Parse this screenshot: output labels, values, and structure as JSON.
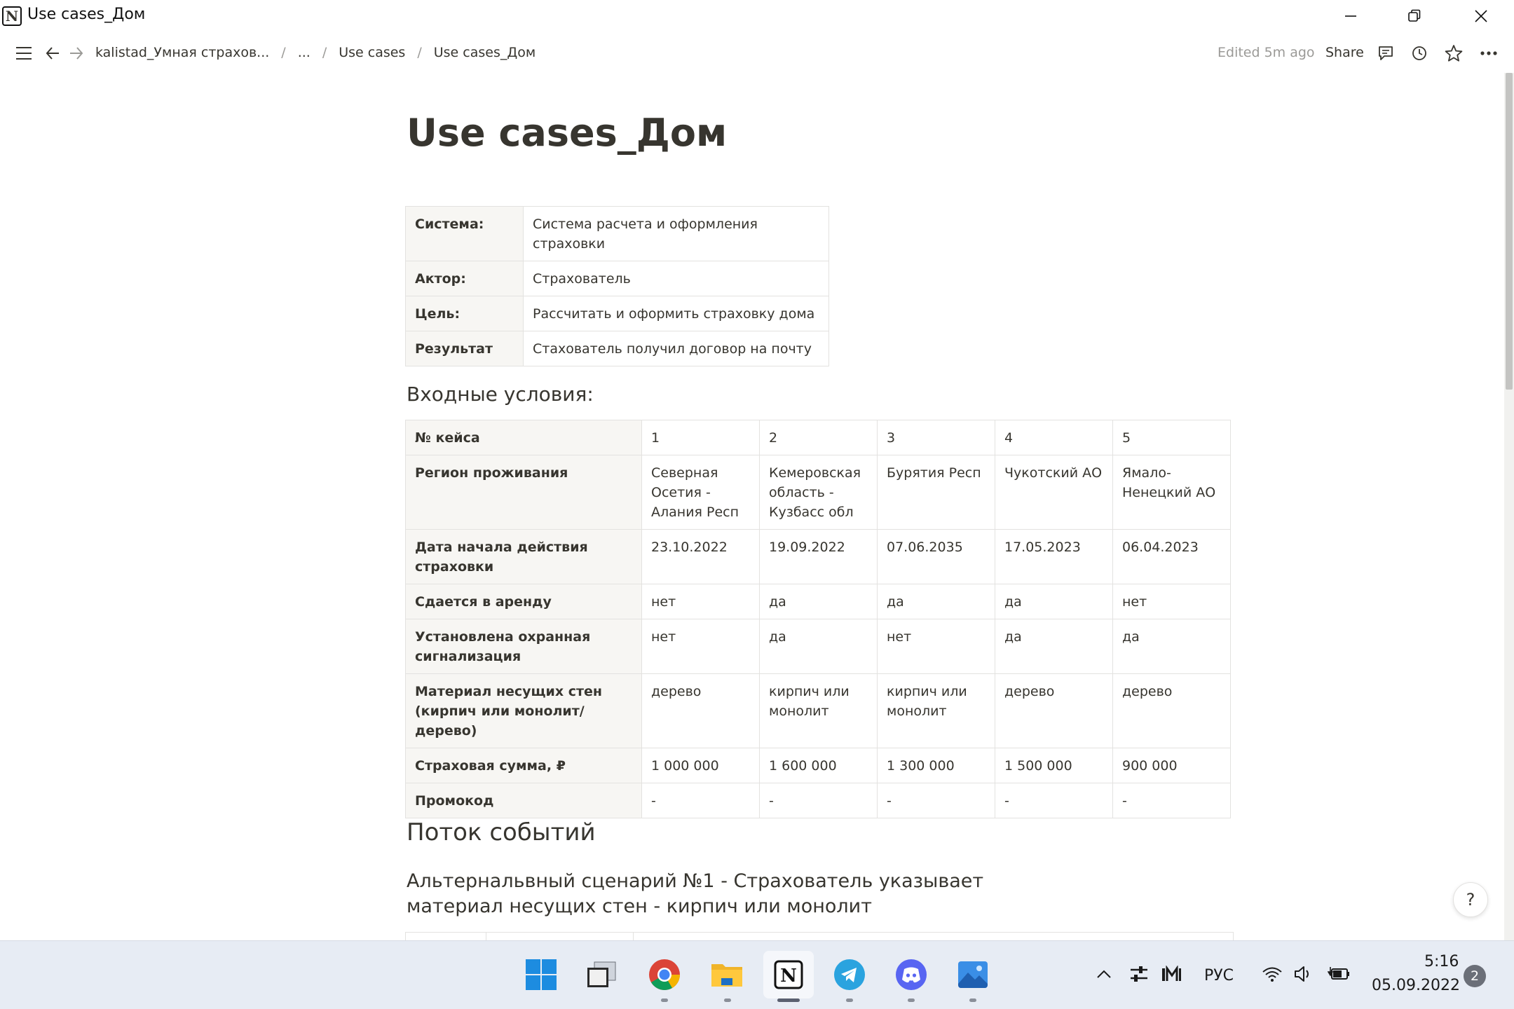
{
  "window": {
    "title": "Use cases_Дом",
    "logo_letter": "N",
    "controls": {
      "minimize": "—",
      "maximize": "❐",
      "close": "✕"
    }
  },
  "topbar": {
    "breadcrumbs": [
      "kalistad_Умная страхов...",
      "...",
      "Use cases",
      "Use cases_Дом"
    ],
    "separator": "/",
    "edited": "Edited 5m ago",
    "share": "Share",
    "icons": [
      "menu-icon",
      "back-icon",
      "forward-icon",
      "comment-icon",
      "history-icon",
      "star-icon",
      "more-icon"
    ]
  },
  "page": {
    "title": "Use cases_Дом",
    "info_table": [
      {
        "label": "Система:",
        "value": "Система расчета и оформления страховки"
      },
      {
        "label": "Актор:",
        "value": "Страхователь"
      },
      {
        "label": "Цель:",
        "value": "Рассчитать и оформить страховку дома"
      },
      {
        "label": "Результат",
        "value": "Стахователь получил договор на почту"
      }
    ],
    "inputs_heading": "Входные условия:",
    "cases_table": [
      {
        "label": "№ кейса",
        "values": [
          "1",
          "2",
          "3",
          "4",
          "5"
        ]
      },
      {
        "label": "Регион проживания",
        "values": [
          "Северная Осетия - Алания Респ",
          "Кемеровская область - Кузбасс обл",
          "Бурятия Респ",
          "Чукотский АО",
          "Ямало-Ненецкий АО"
        ]
      },
      {
        "label": "Дата начала действия страховки",
        "values": [
          "23.10.2022",
          "19.09.2022",
          "07.06.2035",
          "17.05.2023",
          "06.04.2023"
        ]
      },
      {
        "label": "Сдается в аренду",
        "values": [
          "нет",
          "да",
          "да",
          "да",
          "нет"
        ]
      },
      {
        "label": "Установлена охранная сигнализация",
        "values": [
          "нет",
          "да",
          "нет",
          "да",
          "да"
        ]
      },
      {
        "label": "Материал несущих стен (кирпич или монолит/дерево)",
        "values": [
          "дерево",
          "кирпич или монолит",
          "кирпич или монолит",
          "дерево",
          "дерево"
        ]
      },
      {
        "label": "Страховая сумма, ₽",
        "values": [
          "1 000 000",
          "1 600 000",
          "1 300 000",
          "1 500 000",
          "900 000"
        ]
      },
      {
        "label": "Промокод",
        "values": [
          "-",
          "-",
          "-",
          "-",
          "-"
        ]
      }
    ],
    "flow_heading": "Поток событий",
    "alt_heading": "Альтернальвный сценарий №1 - Страхователь указывает материал несущих стен - кирпич или монолит",
    "help": "?"
  },
  "taskbar": {
    "apps": [
      "windows-start",
      "task-view",
      "chrome",
      "file-explorer",
      "notion",
      "telegram",
      "discord",
      "photos"
    ],
    "language": "РУС",
    "time": "5:16",
    "date": "05.09.2022",
    "notifications": "2"
  }
}
